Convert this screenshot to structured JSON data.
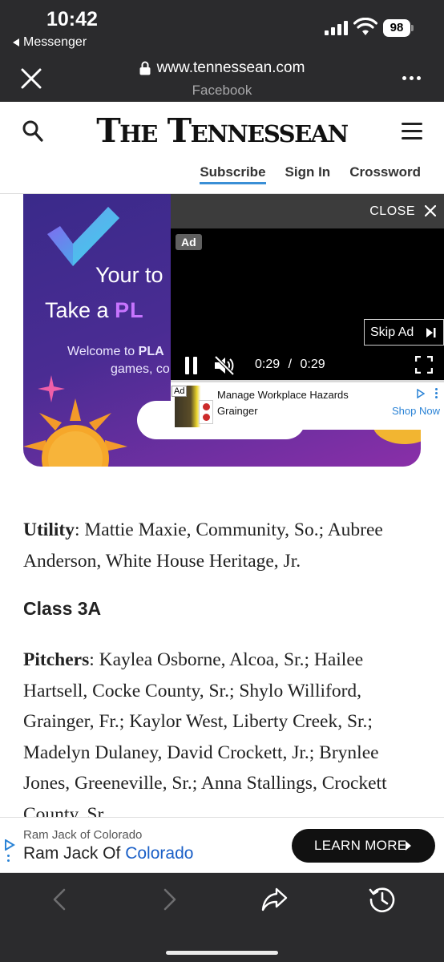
{
  "status_bar": {
    "time": "10:42",
    "back_app": "Messenger",
    "battery": "98"
  },
  "browser": {
    "url": "www.tennessean.com",
    "subtitle": "Facebook"
  },
  "site": {
    "logo": "The Tennessean",
    "nav": {
      "subscribe": "Subscribe",
      "sign_in": "Sign In",
      "crossword": "Crossword"
    }
  },
  "promo": {
    "line1": "Your to",
    "line2_prefix": "Take a",
    "line2_highlight": "PL",
    "line3_prefix": "Welcome to",
    "line3_bold": "PLA",
    "line4": "games, co"
  },
  "video_ad": {
    "close_label": "CLOSE",
    "ad_badge": "Ad",
    "skip_label": "Skip Ad",
    "time_current": "0:29",
    "time_separator": "/",
    "time_total": "0:29",
    "progress_fraction": 1.0,
    "banner": {
      "ad_tag": "Ad",
      "title": "Manage Workplace Hazards",
      "advertiser": "Grainger",
      "cta": "Shop Now"
    }
  },
  "article": {
    "para1_label": "Utility",
    "para1_text": ": Mattie Maxie, Community, So.; Aubree Anderson, White House Heritage, Jr.",
    "heading": "Class 3A",
    "para2_label": "Pitchers",
    "para2_text": ": Kaylea Osborne, Alcoa, Sr.; Hailee Hartsell, Cocke County, Sr.; Shylo Williford, Grainger, Fr.; Kaylor West, Liberty Creek, Sr.; Madelyn Dulaney, David Crockett, Jr.; Brynlee Jones, Greeneville, Sr.; Anna Stallings, Crockett County, Sr."
  },
  "bottom_ad": {
    "advertiser": "Ram Jack of Colorado",
    "headline_prefix": "Ram Jack Of",
    "headline_highlight": "Colorado",
    "cta": "LEARN MORE"
  },
  "colors": {
    "chrome": "#2b2b2d",
    "link_blue": "#2a83d6",
    "subscribe_underline": "#3a8fd6",
    "promo_purple": "#4a2c93"
  },
  "icons": [
    "close-icon",
    "lock-icon",
    "more-icon",
    "search-icon",
    "hamburger-menu-icon",
    "pause-icon",
    "mute-icon",
    "fullscreen-icon",
    "skip-icon",
    "adchoices-icon",
    "back-arrow-icon",
    "forward-arrow-icon",
    "share-icon",
    "history-icon"
  ]
}
